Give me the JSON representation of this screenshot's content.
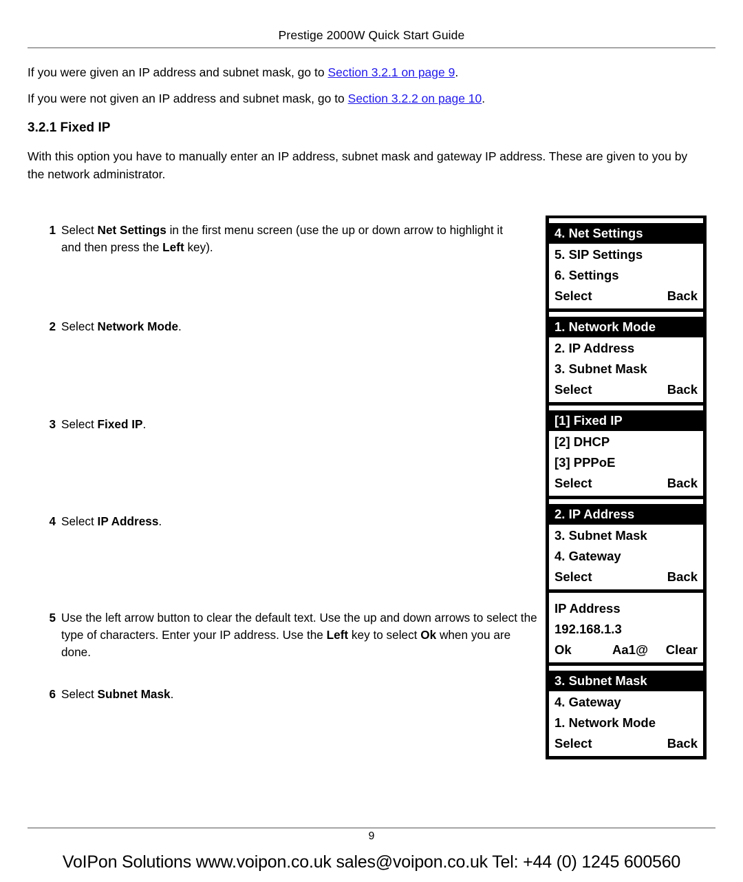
{
  "header": {
    "running_title": "Prestige 2000W Quick Start Guide"
  },
  "intro": {
    "line1_before": "If you were given an IP address and subnet mask, go to ",
    "line1_link": "Section 3.2.1 on page 9",
    "line1_after": ".",
    "line2_before": "If you were not given an IP address and subnet mask, go to ",
    "line2_link": "Section 3.2.2 on page 10",
    "line2_after": ".",
    "link_color": "#2018e8"
  },
  "section": {
    "heading": "3.2.1 Fixed IP",
    "lead": "With this option you have to manually enter an IP address, subnet mask and gateway IP address. These are given to you by the network administrator."
  },
  "steps": [
    {
      "number": "1",
      "parts": [
        {
          "text": "Select ",
          "bold": false
        },
        {
          "text": "Net Settings",
          "bold": true
        },
        {
          "text": " in the first menu screen (use the up or down arrow to highlight it and then press the ",
          "bold": false
        },
        {
          "text": "Left",
          "bold": true
        },
        {
          "text": " key).",
          "bold": false
        }
      ]
    },
    {
      "number": "2",
      "parts": [
        {
          "text": "Select ",
          "bold": false
        },
        {
          "text": "Network Mode",
          "bold": true
        },
        {
          "text": ".",
          "bold": false
        }
      ]
    },
    {
      "number": "3",
      "parts": [
        {
          "text": "Select ",
          "bold": false
        },
        {
          "text": "Fixed IP",
          "bold": true
        },
        {
          "text": ".",
          "bold": false
        }
      ]
    },
    {
      "number": "4",
      "parts": [
        {
          "text": "Select ",
          "bold": false
        },
        {
          "text": "IP Address",
          "bold": true
        },
        {
          "text": ".",
          "bold": false
        }
      ]
    },
    {
      "number": "5",
      "parts": [
        {
          "text": "Use the left arrow button to clear the default text. Use the up and down arrows to select the type of characters. Enter your IP address. Use the ",
          "bold": false
        },
        {
          "text": "Left",
          "bold": true
        },
        {
          "text": " key to select ",
          "bold": false
        },
        {
          "text": "Ok",
          "bold": true
        },
        {
          "text": " when you are done.",
          "bold": false
        }
      ]
    },
    {
      "number": "6",
      "parts": [
        {
          "text": "Select ",
          "bold": false
        },
        {
          "text": "Subnet Mask",
          "bold": true
        },
        {
          "text": ".",
          "bold": false
        }
      ]
    }
  ],
  "lcd_screens": [
    {
      "id": "net-settings-menu",
      "has_title_bar": true,
      "title": "4. Net Settings",
      "rows": [
        {
          "left": "5. SIP Settings"
        },
        {
          "left": "6. Settings"
        },
        {
          "left": "Select",
          "right": "Back"
        }
      ]
    },
    {
      "id": "network-mode-menu",
      "has_title_bar": true,
      "title": "1. Network Mode",
      "rows": [
        {
          "left": "2. IP Address"
        },
        {
          "left": "3. Subnet Mask"
        },
        {
          "left": "Select",
          "right": "Back"
        }
      ]
    },
    {
      "id": "fixed-ip-menu",
      "has_title_bar": true,
      "title": "[1] Fixed IP",
      "rows": [
        {
          "left": "[2] DHCP"
        },
        {
          "left": "[3] PPPoE"
        },
        {
          "left": "Select",
          "right": "Back"
        }
      ]
    },
    {
      "id": "ip-address-menu",
      "has_title_bar": true,
      "title": "2. IP Address",
      "rows": [
        {
          "left": "3. Subnet Mask"
        },
        {
          "left": "4. Gateway"
        },
        {
          "left": "Select",
          "right": "Back"
        }
      ]
    },
    {
      "id": "ip-address-entry",
      "has_title_bar": false,
      "title": "",
      "rows": [
        {
          "left": "IP Address"
        },
        {
          "left": "192.168.1.3"
        },
        {
          "left": "Ok",
          "mid": "Aa1@",
          "right": "Clear"
        }
      ]
    },
    {
      "id": "subnet-mask-menu",
      "has_title_bar": true,
      "title": "3. Subnet Mask",
      "rows": [
        {
          "left": "4. Gateway"
        },
        {
          "left": "1. Network Mode"
        },
        {
          "left": "Select",
          "right": "Back"
        }
      ]
    }
  ],
  "footer": {
    "page_number": "9",
    "vendor_line": "VoIPon Solutions  www.voipon.co.uk  sales@voipon.co.uk  Tel: +44 (0) 1245 600560"
  }
}
